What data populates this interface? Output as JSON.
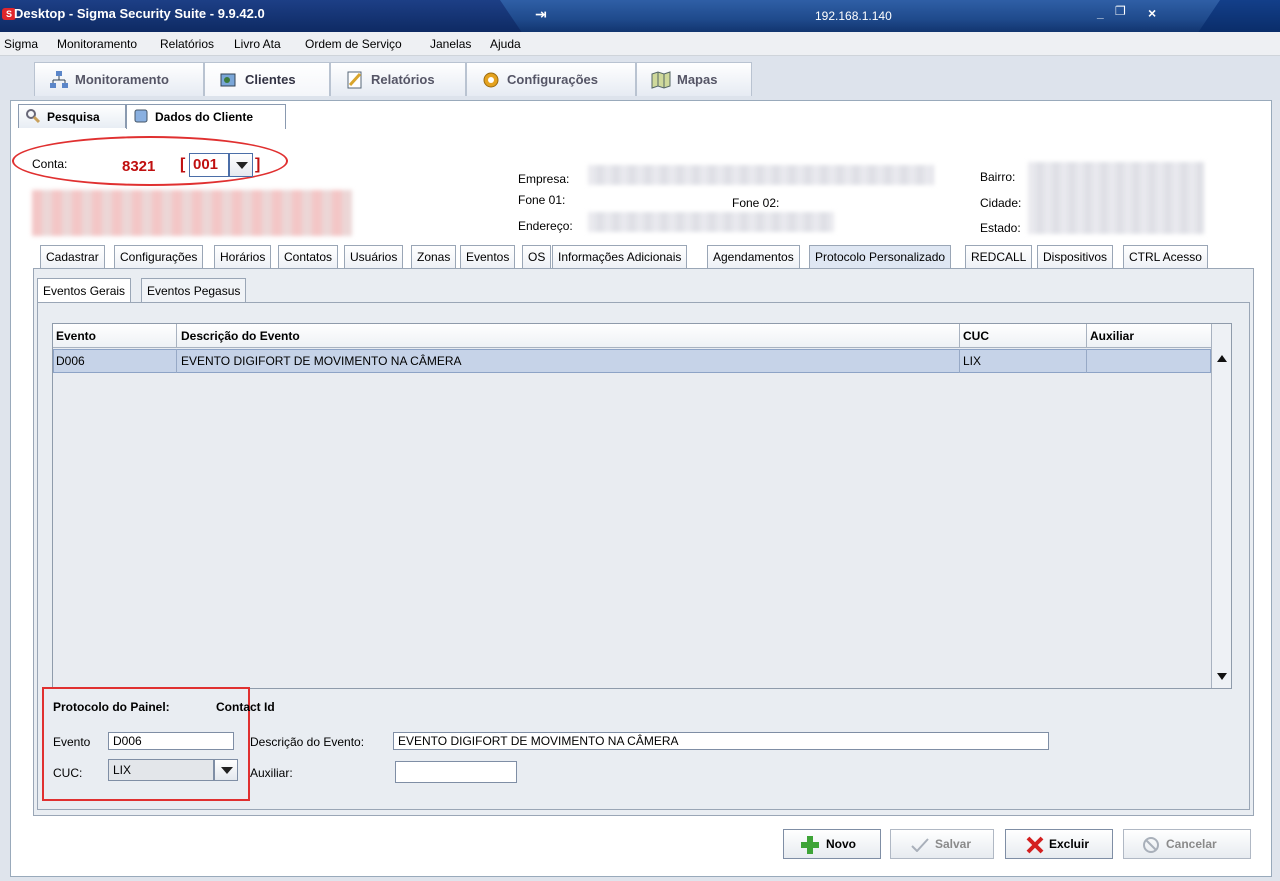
{
  "window": {
    "title": "Desktop - Sigma Security Suite - 9.9.42.0",
    "logo_letter": "S",
    "remote_ip": "192.168.1.140",
    "pin_glyph": "⇥",
    "controls": {
      "minimize": "_",
      "restore": "❐",
      "close": "×"
    }
  },
  "menu": [
    "Sigma",
    "Monitoramento",
    "Relatórios",
    "Livro Ata",
    "Ordem de Serviço",
    "Janelas",
    "Ajuda"
  ],
  "main_tabs": [
    {
      "label": "Monitoramento",
      "icon": "network-icon"
    },
    {
      "label": "Clientes",
      "icon": "clients-icon"
    },
    {
      "label": "Relatórios",
      "icon": "reports-icon"
    },
    {
      "label": "Configurações",
      "icon": "gear-icon"
    },
    {
      "label": "Mapas",
      "icon": "map-icon"
    }
  ],
  "sub_tabs": [
    {
      "label": "Pesquisa",
      "icon": "search-icon"
    },
    {
      "label": "Dados do Cliente",
      "icon": "client-data-icon"
    }
  ],
  "client": {
    "conta_label": "Conta:",
    "conta_number": "8321",
    "bracket_open": "[",
    "bracket_close": "]",
    "partition": "001",
    "empresa_label": "Empresa:",
    "fone1_label": "Fone 01:",
    "fone2_label": "Fone 02:",
    "endereco_label": "Endereço:",
    "bairro_label": "Bairro:",
    "cidade_label": "Cidade:",
    "estado_label": "Estado:"
  },
  "record_tabs": [
    "Cadastrar",
    "Configurações",
    "Horários",
    "Contatos",
    "Usuários",
    "Zonas",
    "Eventos",
    "OS",
    "Informações Adicionais",
    "Agendamentos",
    "Protocolo Personalizado",
    "REDCALL",
    "Dispositivos",
    "CTRL Acesso"
  ],
  "active_record_tab": "Protocolo Personalizado",
  "inner_tabs": [
    "Eventos Gerais",
    "Eventos Pegasus"
  ],
  "table": {
    "columns": [
      "Evento",
      "Descrição do Evento",
      "CUC",
      "Auxiliar"
    ],
    "rows": [
      {
        "evento": "D006",
        "descricao": "EVENTO DIGIFORT DE MOVIMENTO NA CÂMERA",
        "cuc": "LIX",
        "auxiliar": ""
      }
    ]
  },
  "form": {
    "protocolo_label": "Protocolo do Painel:",
    "protocolo_value": "Contact Id",
    "evento_label": "Evento",
    "evento_value": "D006",
    "descricao_label": "Descrição do Evento:",
    "descricao_value": "EVENTO DIGIFORT DE MOVIMENTO NA CÂMERA",
    "cuc_label": "CUC:",
    "cuc_value": "LIX",
    "auxiliar_label": "Auxiliar:",
    "auxiliar_value": ""
  },
  "buttons": {
    "novo": "Novo",
    "salvar": "Salvar",
    "excluir": "Excluir",
    "cancelar": "Cancelar"
  },
  "colors": {
    "title_bar": "#0a2d6a",
    "annotation_red": "#e03030",
    "selected_row": "#c6d3e8"
  }
}
